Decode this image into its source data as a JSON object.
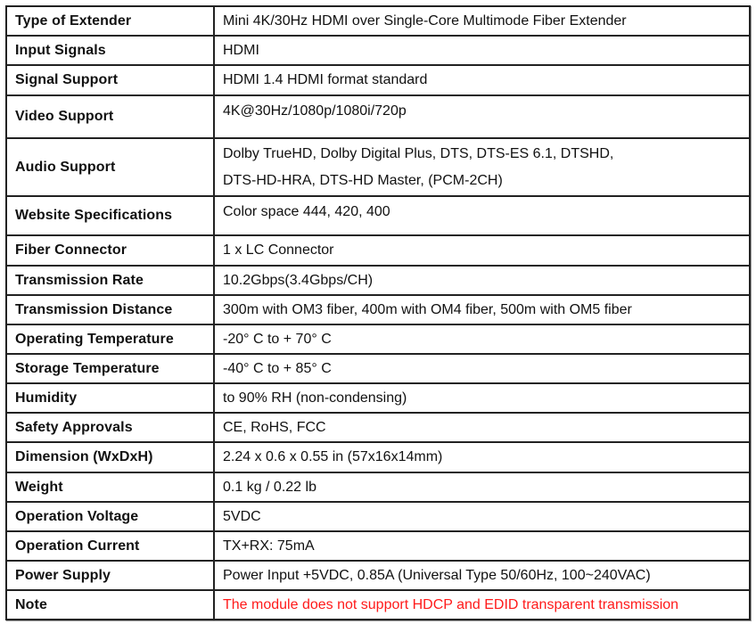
{
  "table": {
    "accent_note_color": "#ff1a1a",
    "rows": [
      {
        "label": "Type of Extender",
        "value": "Mini 4K/30Hz HDMI over Single-Core Multimode Fiber Extender"
      },
      {
        "label": "Input Signals",
        "value": "HDMI"
      },
      {
        "label": "Signal Support",
        "value": "HDMI 1.4 HDMI format standard"
      },
      {
        "label": "Video Support",
        "value": "4K@30Hz/1080p/1080i/720p"
      },
      {
        "label": "Audio Support",
        "value_lines": [
          "Dolby TrueHD, Dolby Digital Plus, DTS, DTS-ES 6.1, DTSHD,",
          "DTS-HD-HRA, DTS-HD Master, (PCM-2CH)"
        ]
      },
      {
        "label": "Website Specifications",
        "value": "Color space 444, 420, 400"
      },
      {
        "label": "Fiber Connector",
        "value": "1 x LC Connector"
      },
      {
        "label": "Transmission Rate",
        "value": "10.2Gbps(3.4Gbps/CH)"
      },
      {
        "label": "Transmission Distance",
        "value": "300m with OM3 fiber, 400m with OM4 fiber, 500m with OM5 fiber"
      },
      {
        "label": "Operating Temperature",
        "value": "-20° C to + 70° C"
      },
      {
        "label": "Storage Temperature",
        "value": "-40° C to + 85° C"
      },
      {
        "label": "Humidity",
        "value": "to 90% RH (non-condensing)"
      },
      {
        "label": "Safety Approvals",
        "value": "CE, RoHS, FCC"
      },
      {
        "label": "Dimension (WxDxH)",
        "value": "2.24 x 0.6 x 0.55 in (57x16x14mm)"
      },
      {
        "label": "Weight",
        "value": "0.1 kg / 0.22 lb"
      },
      {
        "label": "Operation Voltage",
        "value": "5VDC"
      },
      {
        "label": "Operation Current",
        "value": "TX+RX: 75mA"
      },
      {
        "label": "Power Supply",
        "value": "Power Input +5VDC, 0.85A (Universal Type 50/60Hz, 100~240VAC)"
      },
      {
        "label": "Note",
        "value": "The module does not support HDCP and EDID transparent transmission"
      }
    ]
  }
}
